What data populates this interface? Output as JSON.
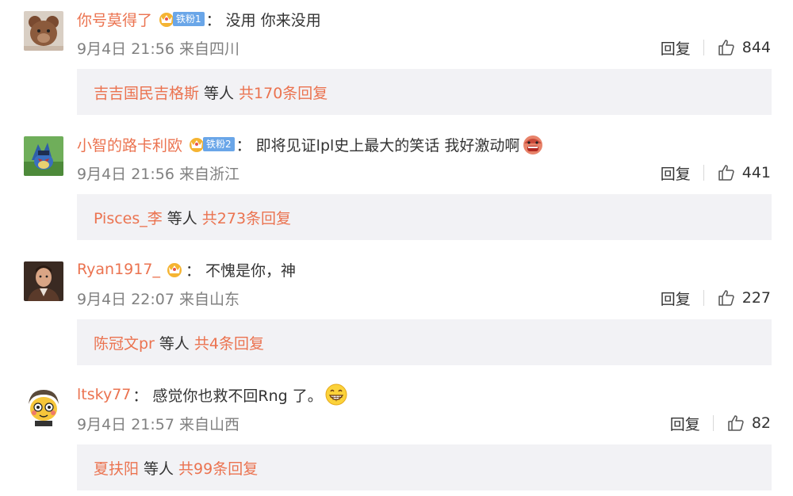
{
  "comments": [
    {
      "username": "你号莫得了",
      "badge": "铁粉1",
      "separator": "：",
      "text": "没用 你来没用",
      "emoji": "",
      "time": "9月4日 21:56 来自四川",
      "reply_label": "回复",
      "likes": "844",
      "replies": {
        "name": "吉吉国民吉格斯",
        "middle": "等人",
        "total": "共170条回复"
      },
      "avatar_icon": "teddy-bear-avatar"
    },
    {
      "username": "小智的路卡利欧",
      "badge": "铁粉2",
      "separator": "：",
      "text": "即将见证lpl史上最大的笑话 我好激动啊",
      "emoji": "excited-emoji",
      "time": "9月4日 21:56 来自浙江",
      "reply_label": "回复",
      "likes": "441",
      "replies": {
        "name": "Pisces_李",
        "middle": "等人",
        "total": "共273条回复"
      },
      "avatar_icon": "lucario-avatar"
    },
    {
      "username": "Ryan1917_",
      "badge": "",
      "separator": "：",
      "text": "不愧是你，神",
      "emoji": "",
      "time": "9月4日 22:07 来自山东",
      "reply_label": "回复",
      "likes": "227",
      "replies": {
        "name": "陈冠文pr",
        "middle": "等人",
        "total": "共4条回复"
      },
      "avatar_icon": "man-portrait-avatar"
    },
    {
      "username": "ltsky77",
      "badge": "",
      "separator": "：",
      "text": "感觉你也救不回Rng 了。",
      "emoji": "grin-emoji",
      "time": "9月4日 21:57 来自山西",
      "reply_label": "回复",
      "likes": "82",
      "replies": {
        "name": "夏扶阳",
        "middle": "等人",
        "total": "共99条回复"
      },
      "avatar_icon": "cartoon-avatar"
    }
  ],
  "colors": {
    "link": "#eb7350",
    "meta": "#808080",
    "reply_bg": "#f2f2f5",
    "fan_badge": "#6aa6e8"
  }
}
